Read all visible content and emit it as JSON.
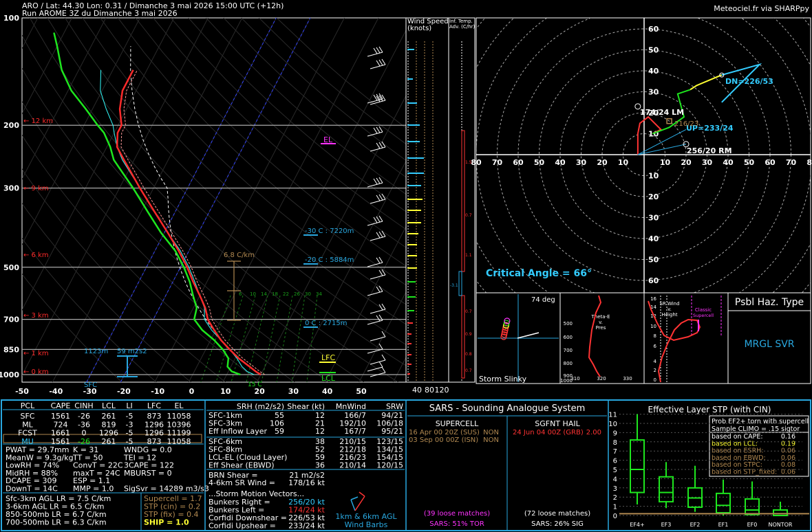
{
  "header": {
    "line1": "ARO / Lat: 44.30 Lon: 0.31 / Dimanche 3 mai 2026 15:00 UTC (+12h)",
    "line2": "Run AROME 3Z du Dimanche 3 mai 2026",
    "credit": "Meteociel.fr via SHARPpy"
  },
  "colors": {
    "temp": "#ff2a2a",
    "dewp": "#1ee61e",
    "virtual": "#ff9999",
    "wetbulb": "#33ffff",
    "parcel": "#ffffff",
    "iso": "#3355ff",
    "panel_border": "#29a8e0",
    "gray": "#888888",
    "tan": "#b08850",
    "magenta": "#ff33ff",
    "yellow": "#ffff33",
    "cyan": "#33ccff"
  },
  "skewt": {
    "pressure_labels": [
      "100",
      "200",
      "300",
      "500",
      "700",
      "850",
      "1000"
    ],
    "temp_ticks": [
      "-50",
      "-40",
      "-30",
      "-20",
      "-10",
      "0",
      "10",
      "20",
      "30",
      "40",
      "50"
    ],
    "height_labels": [
      "12 km",
      "9 km",
      "6 km",
      "3 km",
      "1 km",
      "0 km"
    ],
    "annotations": {
      "el": "EL",
      "lfc": "LFC",
      "lcl": "LCL",
      "sfc": "SFC",
      "lapse": "6.8 C/km",
      "m30": "-30 C : 7220m",
      "m20": "-20 C : 5884m",
      "zero": "0 C : 2715m",
      "effinflow_top": "1123m",
      "effinflow_srh": "59 m2s2",
      "mix_ticks": [
        "6",
        "10",
        "14",
        "18",
        "22",
        "26",
        "30",
        "34"
      ],
      "sfc_temp": "15 C"
    },
    "profiles": {
      "temp": [
        [
          1000,
          20
        ],
        [
          980,
          18
        ],
        [
          950,
          15.5
        ],
        [
          900,
          11
        ],
        [
          850,
          7
        ],
        [
          800,
          3
        ],
        [
          750,
          -0.5
        ],
        [
          700,
          -4
        ],
        [
          650,
          -6.5
        ],
        [
          600,
          -10
        ],
        [
          550,
          -14
        ],
        [
          500,
          -18
        ],
        [
          450,
          -23
        ],
        [
          400,
          -29
        ],
        [
          350,
          -36
        ],
        [
          300,
          -44
        ],
        [
          250,
          -53
        ],
        [
          230,
          -57
        ],
        [
          210,
          -59
        ],
        [
          200,
          -59
        ],
        [
          180,
          -62
        ],
        [
          160,
          -64
        ],
        [
          140,
          -64
        ]
      ],
      "dewp": [
        [
          1000,
          14
        ],
        [
          980,
          11
        ],
        [
          950,
          9
        ],
        [
          900,
          8
        ],
        [
          850,
          5
        ],
        [
          800,
          1
        ],
        [
          750,
          -4
        ],
        [
          700,
          -8
        ],
        [
          650,
          -9
        ],
        [
          600,
          -12
        ],
        [
          550,
          -15
        ],
        [
          500,
          -19
        ],
        [
          450,
          -24
        ],
        [
          400,
          -31
        ],
        [
          350,
          -38
        ],
        [
          300,
          -46
        ],
        [
          250,
          -56
        ],
        [
          230,
          -59
        ],
        [
          210,
          -63
        ],
        [
          200,
          -66
        ],
        [
          180,
          -72
        ],
        [
          160,
          -79
        ],
        [
          140,
          -85
        ],
        [
          120,
          -90
        ],
        [
          110,
          -93
        ]
      ]
    }
  },
  "wind_panel": {
    "title_speed": "Wind Speed",
    "unit": "(knots)",
    "ticks": [
      "40",
      "80",
      "120"
    ],
    "adv_title": "Inf. Temp.",
    "adv_sub": "Adv. (C/hr)",
    "adv_values": [
      "1.5",
      "0.7",
      "1.1",
      "-3.1",
      "0.7",
      "0.9",
      "0.8",
      "0.7"
    ]
  },
  "hodograph": {
    "lm": "174/24 LM",
    "rm": "256/20 RM",
    "dn": "DN=226/53",
    "up": "UP=233/24",
    "mean": "216/23",
    "critical_angle": "Critical Angle = 66°",
    "ring_labels_pos": [
      "10",
      "20",
      "30",
      "40",
      "50",
      "60"
    ],
    "x_labels_left": [
      "80",
      "70",
      "60",
      "50",
      "40",
      "30",
      "20",
      "10"
    ],
    "x_labels_right": [
      "10",
      "20",
      "30",
      "40",
      "50",
      "60",
      "70",
      "80"
    ]
  },
  "storm_slinky": {
    "title": "74 deg",
    "label": "Storm Slinky"
  },
  "theta_panel": {
    "title": "Theta-E",
    "title2": "v.",
    "title3": "Pres",
    "y_labels": [
      "500",
      "600",
      "700",
      "800",
      "900",
      "1000"
    ],
    "x_labels": [
      "310",
      "320",
      "330"
    ]
  },
  "srwind_panel": {
    "title": "SR Wind",
    "title2": "v.",
    "title3": "Height",
    "classic": "Classic",
    "supercell": "Supercell",
    "y_labels": [
      "16",
      "14",
      "12",
      "10",
      "8",
      "6",
      "4",
      "2",
      "0"
    ]
  },
  "hazard": {
    "title": "Psbl Haz. Type",
    "value": "MRGL SVR"
  },
  "parcels": {
    "headers": [
      "PCL",
      "CAPE",
      "CINH",
      "LCL",
      "LI",
      "LFC",
      "EL"
    ],
    "rows": [
      [
        "SFC",
        "1561",
        "-26",
        "261",
        "-5",
        "873",
        "11058"
      ],
      [
        "ML",
        "724",
        "-36",
        "819",
        "-3",
        "1296",
        "10396"
      ],
      [
        "FCST",
        "1661",
        "0",
        "1296",
        "-5",
        "1296",
        "11199"
      ],
      [
        "MU",
        "1561",
        "-26",
        "261",
        "-5",
        "873",
        "11058"
      ]
    ]
  },
  "indices": {
    "col1": [
      "PWAT = 29.7mm",
      "MeanW = 9.3g/kg",
      "LowRH = 74%",
      "MidRH = 88%",
      "DCAPE = 309",
      "DownT = 14C"
    ],
    "col2": [
      "K = 31",
      "TT = 50",
      "ConvT = 22C",
      "maxT = 24C",
      "ESP = 1.1",
      "MMP = 1.0"
    ],
    "col3": [
      "WNDG = 0.0",
      "TEI = 12",
      "3CAPE = 122",
      "MBURST = 0",
      "",
      "SigSvr = 14289 m3/s3"
    ]
  },
  "lapse_rates": [
    "Sfc-3km AGL LR = 7.5 C/km",
    "3-6km AGL LR = 6.5 C/km",
    "850-500mb LR = 6.7 C/km",
    "700-500mb LR = 6.3 C/km"
  ],
  "composite": [
    {
      "label": "Supercell = 1.7",
      "color": "#b08850"
    },
    {
      "label": "STP (cin) = 0.2",
      "color": "#b08850"
    },
    {
      "label": "STP (fix) = 0.4",
      "color": "#b08850"
    },
    {
      "label": "SHIP = 1.0",
      "color": "#ffff33"
    }
  ],
  "kinematics": {
    "headers": [
      "SRH (m2/s2)",
      "Shear (kt)",
      "MnWind",
      "SRW"
    ],
    "rows1": [
      [
        "SFC-1km",
        "55",
        "12",
        "166/7",
        "94/21"
      ],
      [
        "SFC-3km",
        "106",
        "21",
        "192/10",
        "106/18"
      ],
      [
        "Eff Inflow Layer",
        "59",
        "12",
        "167/7",
        "95/21"
      ]
    ],
    "rows2": [
      [
        "SFC-6km",
        "",
        "38",
        "210/15",
        "123/15"
      ],
      [
        "SFC-8km",
        "",
        "52",
        "212/18",
        "134/15"
      ],
      [
        "LCL-EL (Cloud Layer)",
        "",
        "59",
        "216/23",
        "154/15"
      ],
      [
        "Eff Shear (EBWD)",
        "",
        "36",
        "210/14",
        "120/15"
      ]
    ],
    "brn_label": "BRN Shear =",
    "brn_value": "21 m2/s2",
    "srw_label": "4-6km SR Wind =",
    "srw_value": "178/16 kt",
    "sm_title": "...Storm Motion Vectors...",
    "sm_rows": [
      [
        "Bunkers Right =",
        "256/20 kt",
        "#33ccff"
      ],
      [
        "Bunkers Left =",
        "174/24 kt",
        "#ff3333"
      ],
      [
        "Corfidi Downshear =",
        "226/53 kt",
        "#ffffff"
      ],
      [
        "Corfidi Upshear =",
        "233/24 kt",
        "#ffffff"
      ]
    ],
    "barbs_label": "1km & 6km AGL",
    "barbs_label2": "Wind Barbs"
  },
  "sars": {
    "title": "SARS - Sounding Analogue System",
    "supercell": "SUPERCELL",
    "hail": "SGFNT HAIL",
    "sc_matches": [
      [
        "16 Apr 00 20Z (SUS)",
        "NON"
      ],
      [
        "03 Sep 00 00Z (ISN)",
        "NON"
      ]
    ],
    "hail_match_date": "24 Jun 04 00Z (GRB)",
    "hail_match_size": "2.00",
    "loose1": "(39 loose matches)",
    "loose2": "(72 loose matches)",
    "tor": "SARS: 51% TOR",
    "sig": "SARS: 26% SIG"
  },
  "stp": {
    "title": "Effective Layer STP (with CIN)",
    "y_labels": [
      "11",
      "10",
      "9",
      "8",
      "7",
      "6",
      "5",
      "4",
      "3",
      "2",
      "1",
      "0"
    ],
    "cats": [
      "EF4+",
      "EF3",
      "EF2",
      "EF1",
      "EF0",
      "NONTOR"
    ],
    "legend_title": "Prob EF2+ torn with supercell",
    "legend_sub": "Sample CLIMO = .15 sigtor",
    "legend_rows": [
      [
        "based on CAPE:",
        "0.16",
        "#ffffff"
      ],
      [
        "based on LCL:",
        "0.19",
        "#ffff33"
      ],
      [
        "based on ESRH:",
        "0.06",
        "#b08850"
      ],
      [
        "based on EBWD:",
        "0.06",
        "#b08850"
      ],
      [
        "based on STPC:",
        "0.08",
        "#b08850"
      ],
      [
        "based on STP_fixed:",
        "0.06",
        "#b08850"
      ]
    ],
    "boxes": [
      {
        "lo": 1.2,
        "q1": 2.5,
        "med": 5.0,
        "q3": 8.2,
        "hi": 11.0
      },
      {
        "lo": 0.8,
        "q1": 1.5,
        "med": 2.5,
        "q3": 4.2,
        "hi": 5.8
      },
      {
        "lo": 0.4,
        "q1": 0.9,
        "med": 1.9,
        "q3": 3.0,
        "hi": 5.4
      },
      {
        "lo": 0.0,
        "q1": 0.3,
        "med": 1.1,
        "q3": 2.4,
        "hi": 3.9
      },
      {
        "lo": 0.0,
        "q1": 0.1,
        "med": 0.6,
        "q3": 1.8,
        "hi": 3.7
      },
      {
        "lo": 0.0,
        "q1": 0.0,
        "med": 0.2,
        "q3": 0.6,
        "hi": 1.5
      }
    ],
    "current": 0.2
  }
}
